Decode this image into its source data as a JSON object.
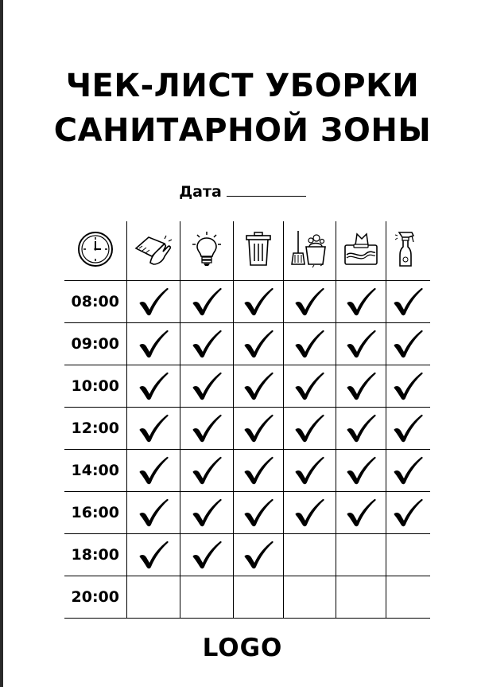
{
  "title": {
    "line1": "ЧЕК-ЛИСТ УБОРКИ",
    "line2": "САНИТАРНОЙ ЗОНЫ"
  },
  "date_label": "Дата",
  "columns": [
    {
      "icon": "clock-icon"
    },
    {
      "icon": "wipe-surface-icon"
    },
    {
      "icon": "light-bulb-icon"
    },
    {
      "icon": "trash-bin-icon"
    },
    {
      "icon": "mop-bucket-icon"
    },
    {
      "icon": "tissue-box-icon"
    },
    {
      "icon": "spray-bottle-icon"
    }
  ],
  "rows": [
    {
      "time": "08:00",
      "checks": [
        true,
        true,
        true,
        true,
        true,
        true
      ]
    },
    {
      "time": "09:00",
      "checks": [
        true,
        true,
        true,
        true,
        true,
        true
      ]
    },
    {
      "time": "10:00",
      "checks": [
        true,
        true,
        true,
        true,
        true,
        true
      ]
    },
    {
      "time": "12:00",
      "checks": [
        true,
        true,
        true,
        true,
        true,
        true
      ]
    },
    {
      "time": "14:00",
      "checks": [
        true,
        true,
        true,
        true,
        true,
        true
      ]
    },
    {
      "time": "16:00",
      "checks": [
        true,
        true,
        true,
        true,
        true,
        true
      ]
    },
    {
      "time": "18:00",
      "checks": [
        true,
        true,
        true,
        false,
        false,
        false
      ]
    },
    {
      "time": "20:00",
      "checks": [
        false,
        false,
        false,
        false,
        false,
        false
      ]
    }
  ],
  "logo": "LOGO"
}
